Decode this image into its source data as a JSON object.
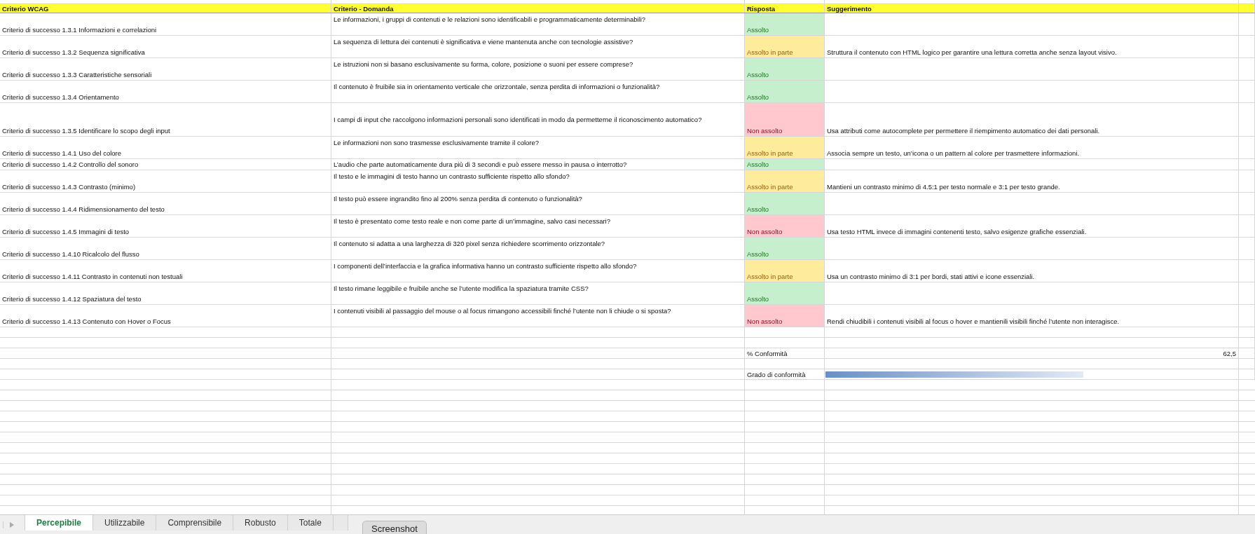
{
  "columns": [
    "Criterio WCAG",
    "Criterio - Domanda",
    "Risposta",
    "Suggerimento"
  ],
  "rows": [
    {
      "kind": "standard",
      "criterion": "Criterio di successo 1.3.1 Informazioni e correlazioni",
      "question": "Le informazioni, i gruppi di contenuti e le relazioni sono identificabili e programmaticamente determinabili?",
      "answer": "Assolto",
      "color": "#c6efce"
    },
    {
      "kind": "standard",
      "criterion": "Criterio di successo 1.3.2 Sequenza significativa",
      "question": "La sequenza di lettura dei contenuti è significativa e viene mantenuta anche con tecnologie assistive?",
      "answer": "Assolto in parte",
      "color": "#ffeb9c",
      "suggestion": "Struttura il contenuto con HTML logico per garantire una lettura corretta anche senza layout visivo."
    },
    {
      "kind": "standard",
      "criterion": "Criterio di successo 1.3.3 Caratteristiche sensoriali",
      "question": "Le istruzioni non si basano esclusivamente su forma, colore, posizione o suoni per essere comprese?",
      "answer": "Assolto",
      "color": "#c6efce"
    },
    {
      "kind": "standard",
      "criterion": "Criterio di successo 1.3.4 Orientamento",
      "question": "Il contenuto è fruibile sia in orientamento verticale che orizzontale, senza perdita di informazioni o funzionalità?",
      "answer": "Assolto",
      "color": "#c6efce"
    },
    {
      "kind": "tall",
      "criterion": "Criterio di successo 1.3.5 Identificare lo scopo degli input",
      "question": "I campi di input che raccolgono informazioni personali sono identificati in modo da permetterne il riconoscimento automatico?",
      "answer": "Non assolto",
      "color": "#ffc7ce",
      "suggestion": "Usa attributi come autocomplete per permettere il riempimento automatico dei dati personali."
    },
    {
      "kind": "standard",
      "criterion": "Criterio di successo 1.4.1 Uso del colore",
      "question": "Le informazioni non sono trasmesse esclusivamente tramite il colore?",
      "answer": "Assolto in parte",
      "color": "#ffeb9c",
      "suggestion": "Associa sempre un testo, un’icona o un pattern al colore per trasmettere informazioni."
    },
    {
      "kind": "compact",
      "criterion": "Criterio di successo 1.4.2 Controllo del sonoro",
      "question": "L’audio che parte automaticamente dura più di 3 secondi e può essere messo in pausa o interrotto?",
      "answer": "Assolto",
      "color": "#c6efce"
    },
    {
      "kind": "standard",
      "criterion": "Criterio di successo 1.4.3 Contrasto (minimo)",
      "question": "Il testo e le immagini di testo hanno un contrasto sufficiente rispetto allo sfondo?",
      "answer": "Assolto in parte",
      "color": "#ffeb9c",
      "suggestion": "Mantieni un contrasto minimo di 4.5:1 per testo normale e 3:1 per testo grande."
    },
    {
      "kind": "standard",
      "criterion": "Criterio di successo 1.4.4 Ridimensionamento del testo",
      "question": "Il testo può essere ingrandito fino al 200% senza perdita di contenuto o funzionalità?",
      "answer": "Assolto",
      "color": "#c6efce"
    },
    {
      "kind": "standard",
      "criterion": "Criterio di successo 1.4.5 Immagini di testo",
      "question": "Il testo è presentato come testo reale e non come parte di un’immagine, salvo casi necessari?",
      "answer": "Non assolto",
      "color": "#ffc7ce",
      "suggestion": "Usa testo HTML invece di immagini contenenti testo, salvo esigenze grafiche essenziali."
    },
    {
      "kind": "standard",
      "criterion": "Criterio di successo 1.4.10 Ricalcolo del flusso",
      "question": "Il contenuto si adatta a una larghezza di 320 pixel senza richiedere scorrimento orizzontale?",
      "answer": "Assolto",
      "color": "#c6efce"
    },
    {
      "kind": "standard",
      "criterion": "Criterio di successo 1.4.11 Contrasto in contenuti non testuali",
      "question": "I componenti dell’interfaccia e la grafica informativa hanno un contrasto sufficiente rispetto allo sfondo?",
      "answer": "Assolto in parte",
      "color": "#ffeb9c",
      "suggestion": "Usa un contrasto minimo di 3:1 per bordi, stati attivi e icone essenziali."
    },
    {
      "kind": "standard",
      "criterion": "Criterio di successo 1.4.12 Spaziatura del testo",
      "question": "Il testo rimane leggibile e fruibile anche se l’utente modifica la spaziatura tramite CSS?",
      "answer": "Assolto",
      "color": "#c6efce"
    },
    {
      "kind": "standard",
      "criterion": "Criterio di successo 1.4.13 Contenuto con Hover o Focus",
      "question": "I contenuti visibili al passaggio del mouse o al focus rimangono accessibili finché l’utente non li chiude o si sposta?",
      "answer": "Non assolto",
      "color": "#ffc7ce",
      "suggestion": "Rendi chiudibili i contenuti visibili al focus o hover e mantienili visibili finché l’utente non interagisce."
    }
  ],
  "summary": {
    "conformity_label": "% Conformità",
    "conformity_value": "62,5",
    "grade_label": "Grado di conformità",
    "level": 0.625
  },
  "tabs": [
    {
      "label": "Percepibile",
      "selected": true
    },
    {
      "label": "Utilizzabile",
      "selected": false
    },
    {
      "label": "Comprensibile",
      "selected": false
    },
    {
      "label": "Robusto",
      "selected": false
    },
    {
      "label": "Totale",
      "selected": false
    }
  ],
  "tooltip": "Screenshot"
}
